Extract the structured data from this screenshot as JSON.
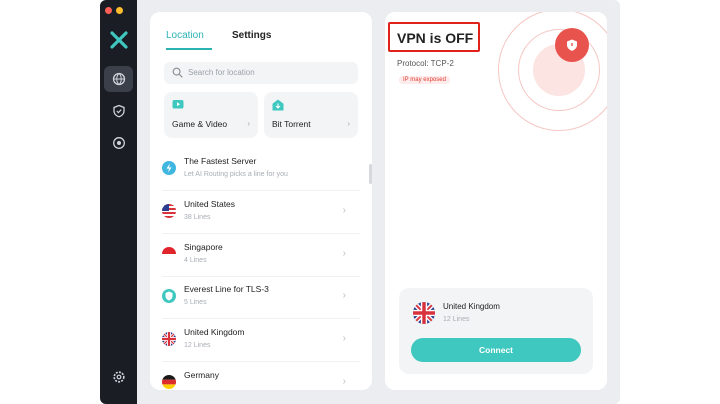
{
  "tabs": {
    "location": "Location",
    "settings": "Settings"
  },
  "search": {
    "placeholder": "Search for location"
  },
  "categories": [
    {
      "label": "Game & Video",
      "icon": "game-video-icon"
    },
    {
      "label": "Bit Torrent",
      "icon": "bit-torrent-icon"
    }
  ],
  "servers": [
    {
      "name": "The Fastest Server",
      "sub": "Let AI Routing picks a line for you",
      "icon": "lightning-icon"
    },
    {
      "name": "United States",
      "sub": "38 Lines",
      "icon": "us-flag-icon"
    },
    {
      "name": "Singapore",
      "sub": "4 Lines",
      "icon": "sg-flag-icon"
    },
    {
      "name": "Everest Line for TLS-3",
      "sub": "5 Lines",
      "icon": "shield-icon"
    },
    {
      "name": "United Kingdom",
      "sub": "12 Lines",
      "icon": "uk-flag-icon"
    },
    {
      "name": "Germany",
      "sub": "",
      "icon": "de-flag-icon"
    }
  ],
  "status": {
    "title": "VPN is OFF",
    "protocol": "Protocol: TCP-2",
    "ip_badge": "IP may exposed"
  },
  "connection": {
    "location": "United Kingdom",
    "lines": "12 Lines",
    "connect_label": "Connect"
  },
  "colors": {
    "accent": "#3fc8c0",
    "danger": "#e9534e",
    "highlight": "#e0221a",
    "sidebar": "#1a1d24"
  }
}
